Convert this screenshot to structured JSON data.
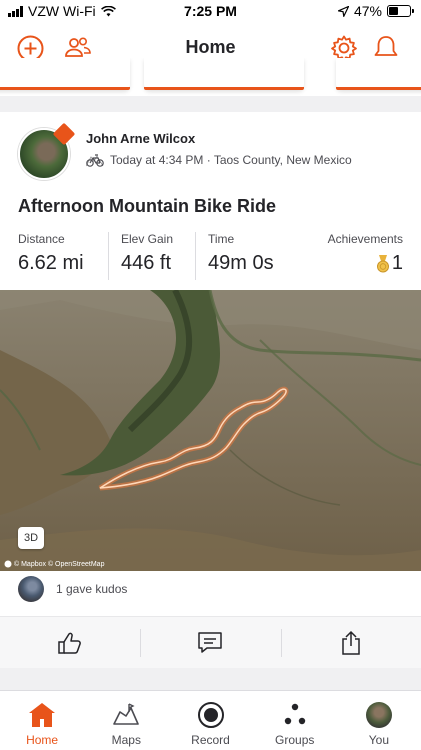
{
  "status_bar": {
    "carrier": "VZW Wi-Fi",
    "time": "7:25 PM",
    "battery": "47%",
    "battery_level": 0.47
  },
  "header": {
    "title": "Home"
  },
  "activity": {
    "athlete": "John Arne Wilcox",
    "meta": "Today at 4:34 PM · Taos County, New Mexico",
    "title": "Afternoon Mountain Bike Ride",
    "stats": [
      {
        "label": "Distance",
        "value": "6.62 mi"
      },
      {
        "label": "Elev Gain",
        "value": "446 ft"
      },
      {
        "label": "Time",
        "value": "49m 0s"
      }
    ],
    "achievements": {
      "label": "Achievements",
      "value": "1"
    },
    "map": {
      "toggle_3d": "3D",
      "attribution": "© Mapbox © OpenStreetMap"
    },
    "kudos": "1 gave kudos"
  },
  "tabs": [
    {
      "label": "Home",
      "icon": "home-icon",
      "active": true
    },
    {
      "label": "Maps",
      "icon": "maps-icon"
    },
    {
      "label": "Record",
      "icon": "record-icon"
    },
    {
      "label": "Groups",
      "icon": "groups-icon"
    },
    {
      "label": "You",
      "icon": "profile-avatar"
    }
  ],
  "colors": {
    "accent": "#e8541a",
    "text": "#242428",
    "muted": "#4c4c52"
  }
}
